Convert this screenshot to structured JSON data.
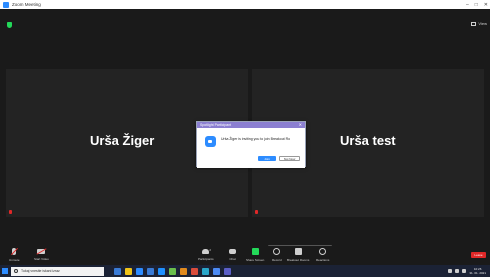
{
  "window": {
    "title": "Zoom Meeting",
    "controls": [
      "–",
      "□",
      "✕"
    ]
  },
  "meeting": {
    "view_label": "View",
    "participants": [
      {
        "name": "Urša Žiger"
      },
      {
        "name": "Urša test"
      }
    ],
    "security_color": "#23d959"
  },
  "dialog": {
    "title": "Spotlight Participant",
    "message": "Urša Žiger is inviting you to join Breakout Ro",
    "allow_label": "Join",
    "deny_label": "Not Now",
    "close_label": "✕",
    "accent": "#2D8CFF"
  },
  "broadcast": {
    "label": "Join a broadcast room"
  },
  "controls": {
    "unmute": "Unmute",
    "start_video": "Start Video",
    "participants": "Participants",
    "participants_count": "2",
    "chat": "Chat",
    "share_screen": "Share Screen",
    "record": "Record",
    "breakout_rooms": "Breakout Rooms",
    "reactions": "Reactions",
    "leave": "Leave"
  },
  "taskbar": {
    "search_placeholder": "Tukaj vnesite iskani izraz",
    "time": "10:26",
    "date": "31. 01. 2021",
    "app_colors": [
      "#3a7bd5",
      "#f0c419",
      "#2D8CFF",
      "#3a7bd5",
      "#1e90ff",
      "#6abf4b",
      "#e08a1e",
      "#d94c3b",
      "#2aa6c9",
      "#4c8bf5",
      "#5b5fc7"
    ]
  }
}
